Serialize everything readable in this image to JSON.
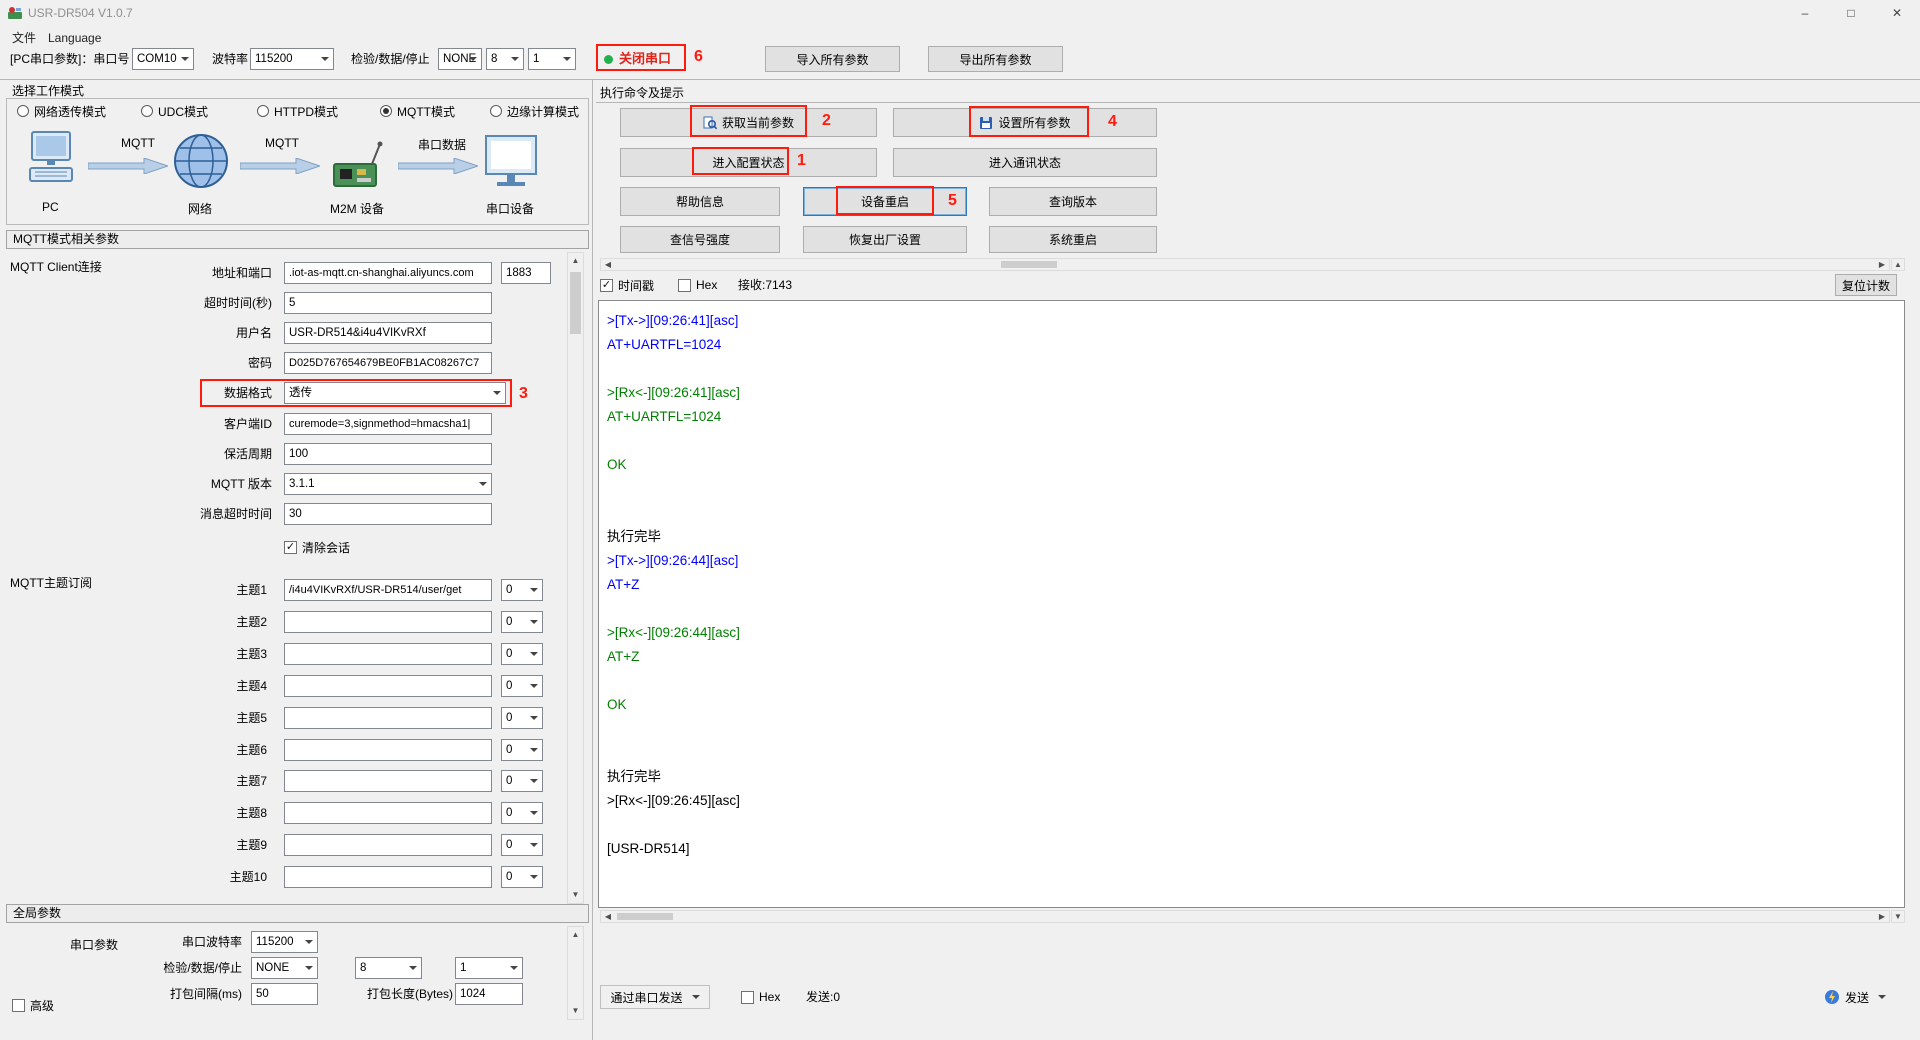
{
  "window": {
    "title": "USR-DR504 V1.0.7"
  },
  "menu": {
    "file": "文件",
    "language": "Language"
  },
  "toolbar": {
    "pc_serial_label": "[PC串口参数]：串口号",
    "port": "COM10",
    "baud_label": "波特率",
    "baud": "115200",
    "parity_label": "检验/数据/停止",
    "parity": "NONE",
    "databits": "8",
    "stopbits": "1",
    "close_port": "关闭串口",
    "import_all": "导入所有参数",
    "export_all": "导出所有参数"
  },
  "work_mode": {
    "title": "选择工作模式",
    "options": [
      {
        "label": "网络透传模式",
        "selected": false
      },
      {
        "label": "UDC模式",
        "selected": false
      },
      {
        "label": "HTTPD模式",
        "selected": false
      },
      {
        "label": "MQTT模式",
        "selected": true
      },
      {
        "label": "边缘计算模式",
        "selected": false
      }
    ],
    "diagram": {
      "pc": "PC",
      "mqtt_left": "MQTT",
      "network": "网络",
      "mqtt_right": "MQTT",
      "m2m": "M2M 设备",
      "serial_data": "串口数据",
      "serial_device": "串口设备"
    }
  },
  "mqtt": {
    "section_title": "MQTT模式相关参数",
    "client_group": "MQTT Client连接",
    "addr_label": "地址和端口",
    "addr": ".iot-as-mqtt.cn-shanghai.aliyuncs.com",
    "port": "1883",
    "timeout_label": "超时时间(秒)",
    "timeout": "5",
    "username_label": "用户名",
    "username": "USR-DR514&i4u4VIKvRXf",
    "password_label": "密码",
    "password": "D025D767654679BE0FB1AC08267C7",
    "format_label": "数据格式",
    "format": "透传",
    "client_id_label": "客户端ID",
    "client_id": "curemode=3,signmethod=hmacsha1|",
    "keepalive_label": "保活周期",
    "keepalive": "100",
    "version_label": "MQTT 版本",
    "version": "3.1.1",
    "msg_timeout_label": "消息超时时间",
    "msg_timeout": "30",
    "clean_session_label": "清除会话",
    "subscribe_group": "MQTT主题订阅",
    "topics": [
      {
        "label": "主题1",
        "value": "/i4u4VIKvRXf/USR-DR514/user/get",
        "qos": "0"
      },
      {
        "label": "主题2",
        "value": "",
        "qos": "0"
      },
      {
        "label": "主题3",
        "value": "",
        "qos": "0"
      },
      {
        "label": "主题4",
        "value": "",
        "qos": "0"
      },
      {
        "label": "主题5",
        "value": "",
        "qos": "0"
      },
      {
        "label": "主题6",
        "value": "",
        "qos": "0"
      },
      {
        "label": "主题7",
        "value": "",
        "qos": "0"
      },
      {
        "label": "主题8",
        "value": "",
        "qos": "0"
      },
      {
        "label": "主题9",
        "value": "",
        "qos": "0"
      },
      {
        "label": "主题10",
        "value": "",
        "qos": "0"
      }
    ]
  },
  "global": {
    "section_title": "全局参数",
    "serial_group_label": "串口参数",
    "baud_label": "串口波特率",
    "baud": "115200",
    "parity_label": "检验/数据/停止",
    "parity": "NONE",
    "databits": "8",
    "stopbits": "1",
    "pack_interval_label": "打包间隔(ms)",
    "pack_interval": "50",
    "pack_length_label": "打包长度(Bytes)",
    "pack_length": "1024",
    "advanced_label": "高级"
  },
  "commands": {
    "title": "执行命令及提示",
    "get_params": "获取当前参数",
    "set_params": "设置所有参数",
    "enter_config": "进入配置状态",
    "enter_comm": "进入通讯状态",
    "help": "帮助信息",
    "device_restart": "设备重启",
    "query_version": "查询版本",
    "signal_strength": "查信号强度",
    "factory_reset": "恢复出厂设置",
    "system_restart": "系统重启"
  },
  "log": {
    "timestamp_label": "时间戳",
    "hex_label": "Hex",
    "recv_count": "接收:7143",
    "reset_count": "复位计数",
    "lines": [
      {
        "t": ">[Tx->][09:26:41][asc]",
        "c": "tx"
      },
      {
        "t": "AT+UARTFL=1024",
        "c": "tx"
      },
      {
        "t": "",
        "c": "plain"
      },
      {
        "t": ">[Rx<-][09:26:41][asc]",
        "c": "rx"
      },
      {
        "t": "AT+UARTFL=1024",
        "c": "rx"
      },
      {
        "t": "",
        "c": "plain"
      },
      {
        "t": "OK",
        "c": "rx"
      },
      {
        "t": "",
        "c": "plain"
      },
      {
        "t": "",
        "c": "plain"
      },
      {
        "t": "执行完毕",
        "c": "plain"
      },
      {
        "t": ">[Tx->][09:26:44][asc]",
        "c": "tx"
      },
      {
        "t": "AT+Z",
        "c": "tx"
      },
      {
        "t": "",
        "c": "plain"
      },
      {
        "t": ">[Rx<-][09:26:44][asc]",
        "c": "rx"
      },
      {
        "t": "AT+Z",
        "c": "rx"
      },
      {
        "t": "",
        "c": "plain"
      },
      {
        "t": "OK",
        "c": "rx"
      },
      {
        "t": "",
        "c": "plain"
      },
      {
        "t": "",
        "c": "plain"
      },
      {
        "t": "执行完毕",
        "c": "plain"
      },
      {
        "t": ">[Rx<-][09:26:45][asc]",
        "c": "plain"
      },
      {
        "t": "",
        "c": "plain"
      },
      {
        "t": "[USR-DR514]",
        "c": "plain"
      }
    ]
  },
  "send": {
    "via_serial": "通过串口发送",
    "hex_label": "Hex",
    "sent_count": "发送:0",
    "send_label": "发送"
  },
  "annotations": {
    "n1": "1",
    "n2": "2",
    "n3": "3",
    "n4": "4",
    "n5": "5",
    "n6": "6"
  },
  "colors": {
    "accent_red": "#ff1a0e",
    "tx_blue": "#0000ff",
    "rx_green": "#008000",
    "status_green": "#22b14c"
  }
}
